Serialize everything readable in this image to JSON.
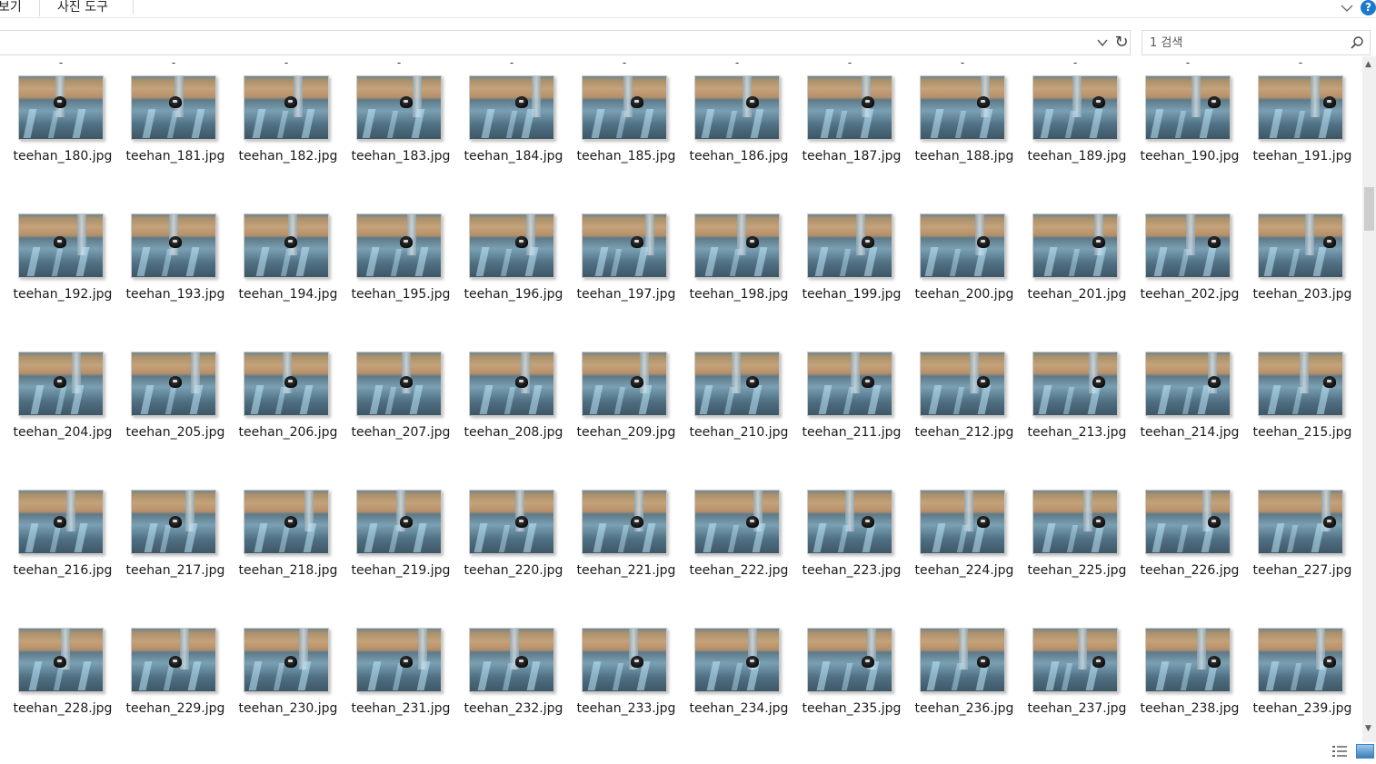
{
  "ribbon": {
    "tabs": [
      "보기",
      "사진 도구"
    ],
    "help": "?"
  },
  "address_bar": {
    "value": ""
  },
  "search": {
    "placeholder": "1 검색"
  },
  "previous_row_labels": [
    "-",
    "-",
    "-",
    "-",
    "-",
    "-",
    "-",
    "-",
    "-",
    "-",
    "-",
    "-"
  ],
  "files": [
    "teehan_180.jpg",
    "teehan_181.jpg",
    "teehan_182.jpg",
    "teehan_183.jpg",
    "teehan_184.jpg",
    "teehan_185.jpg",
    "teehan_186.jpg",
    "teehan_187.jpg",
    "teehan_188.jpg",
    "teehan_189.jpg",
    "teehan_190.jpg",
    "teehan_191.jpg",
    "teehan_192.jpg",
    "teehan_193.jpg",
    "teehan_194.jpg",
    "teehan_195.jpg",
    "teehan_196.jpg",
    "teehan_197.jpg",
    "teehan_198.jpg",
    "teehan_199.jpg",
    "teehan_200.jpg",
    "teehan_201.jpg",
    "teehan_202.jpg",
    "teehan_203.jpg",
    "teehan_204.jpg",
    "teehan_205.jpg",
    "teehan_206.jpg",
    "teehan_207.jpg",
    "teehan_208.jpg",
    "teehan_209.jpg",
    "teehan_210.jpg",
    "teehan_211.jpg",
    "teehan_212.jpg",
    "teehan_213.jpg",
    "teehan_214.jpg",
    "teehan_215.jpg",
    "teehan_216.jpg",
    "teehan_217.jpg",
    "teehan_218.jpg",
    "teehan_219.jpg",
    "teehan_220.jpg",
    "teehan_221.jpg",
    "teehan_222.jpg",
    "teehan_223.jpg",
    "teehan_224.jpg",
    "teehan_225.jpg",
    "teehan_226.jpg",
    "teehan_227.jpg",
    "teehan_228.jpg",
    "teehan_229.jpg",
    "teehan_230.jpg",
    "teehan_231.jpg",
    "teehan_232.jpg",
    "teehan_233.jpg",
    "teehan_234.jpg",
    "teehan_235.jpg",
    "teehan_236.jpg",
    "teehan_237.jpg",
    "teehan_238.jpg",
    "teehan_239.jpg"
  ],
  "colors": {
    "accent": "#1979ca",
    "border": "#d9d9d9",
    "scrollbar_track": "#f0f0f0",
    "scrollbar_thumb": "#cdcdcd"
  },
  "icons": {
    "ribbon_expand": "chevron-down-icon",
    "help": "help-icon",
    "address_dropdown": "chevron-down-icon",
    "refresh": "refresh-icon",
    "search": "search-icon",
    "details_view": "details-view-icon",
    "large_icons_view": "large-icons-view-icon"
  }
}
